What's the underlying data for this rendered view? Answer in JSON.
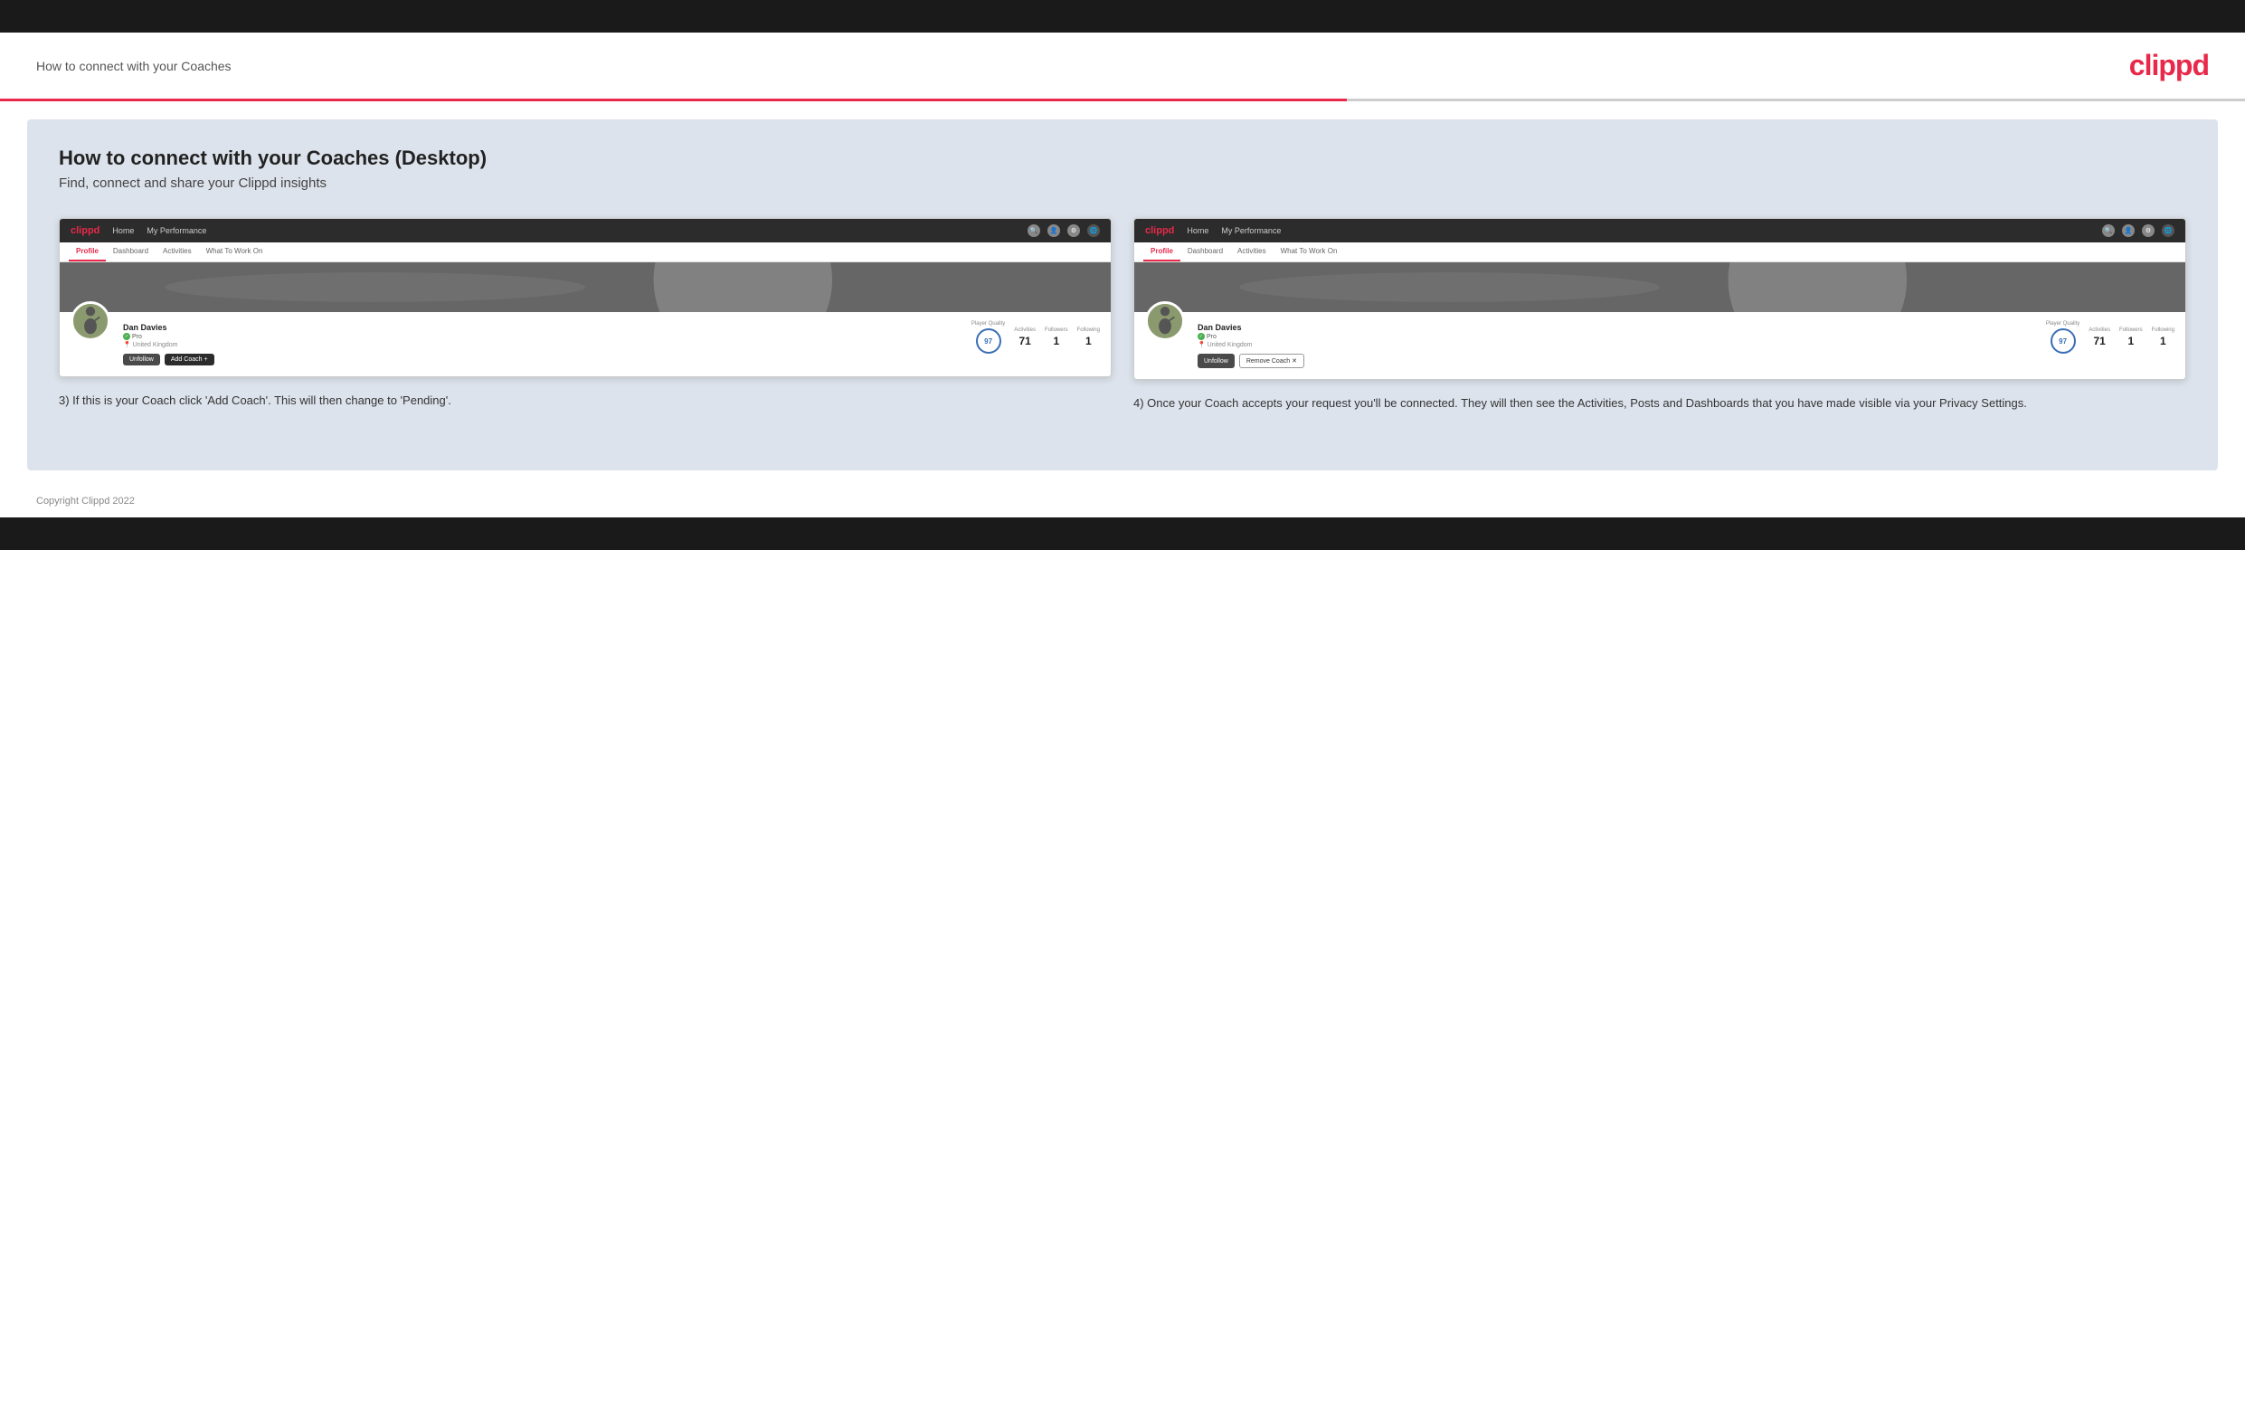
{
  "header": {
    "title": "How to connect with your Coaches",
    "logo": "clippd"
  },
  "main": {
    "heading": "How to connect with your Coaches (Desktop)",
    "subheading": "Find, connect and share your Clippd insights",
    "screenshot1": {
      "navbar": {
        "logo": "clippd",
        "nav_items": [
          "Home",
          "My Performance"
        ]
      },
      "tabs": [
        "Profile",
        "Dashboard",
        "Activities",
        "What To Work On"
      ],
      "active_tab": "Profile",
      "player": {
        "name": "Dan Davies",
        "badge": "Pro",
        "location": "United Kingdom",
        "player_quality": "97",
        "player_quality_label": "Player Quality",
        "activities": "71",
        "activities_label": "Activities",
        "followers": "1",
        "followers_label": "Followers",
        "following": "1",
        "following_label": "Following"
      },
      "buttons": {
        "unfollow": "Unfollow",
        "add_coach": "Add Coach"
      }
    },
    "screenshot2": {
      "navbar": {
        "logo": "clippd",
        "nav_items": [
          "Home",
          "My Performance"
        ]
      },
      "tabs": [
        "Profile",
        "Dashboard",
        "Activities",
        "What To Work On"
      ],
      "active_tab": "Profile",
      "player": {
        "name": "Dan Davies",
        "badge": "Pro",
        "location": "United Kingdom",
        "player_quality": "97",
        "player_quality_label": "Player Quality",
        "activities": "71",
        "activities_label": "Activities",
        "followers": "1",
        "followers_label": "Followers",
        "following": "1",
        "following_label": "Following"
      },
      "buttons": {
        "unfollow": "Unfollow",
        "remove_coach": "Remove Coach"
      }
    },
    "description1": "3) If this is your Coach click 'Add Coach'. This will then change to 'Pending'.",
    "description2": "4) Once your Coach accepts your request you'll be connected. They will then see the Activities, Posts and Dashboards that you have made visible via your Privacy Settings."
  },
  "footer": {
    "copyright": "Copyright Clippd 2022"
  }
}
